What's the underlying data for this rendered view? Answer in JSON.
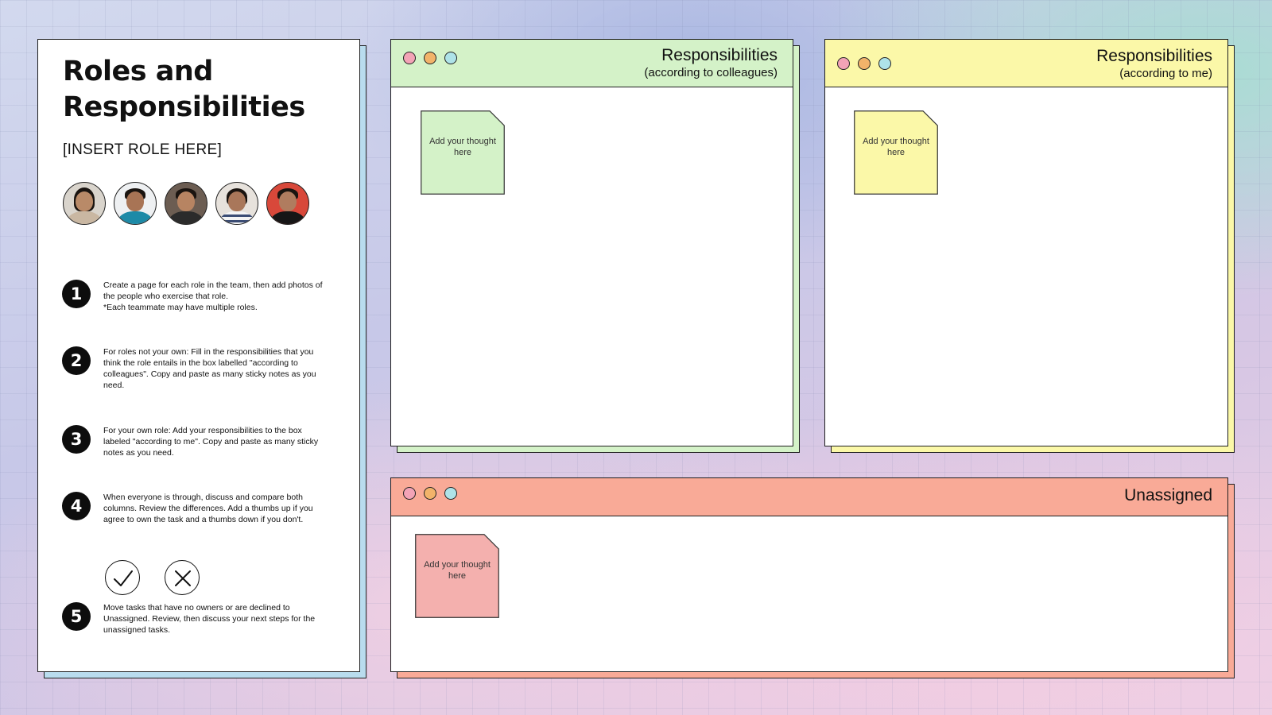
{
  "instructions": {
    "title": "Roles and Responsibilities",
    "role_placeholder": "[INSERT ROLE HERE]",
    "steps": [
      {
        "number": "1",
        "text": "Create a page for each role in the team, then add photos of the people who exercise that role.\n*Each teammate may have multiple roles."
      },
      {
        "number": "2",
        "text": "For roles not your own: Fill in the responsibilities that you think the role entails in the box labelled \"according to colleagues\". Copy and paste as many sticky notes as you need."
      },
      {
        "number": "3",
        "text": "For your own role: Add your responsibilities to the box labeled \"according to me\". Copy and paste as many sticky notes as you need."
      },
      {
        "number": "4",
        "text": "When everyone is through, discuss and compare both columns. Review the differences. Add a thumbs up if you agree to own the task and a thumbs down if you don't."
      },
      {
        "number": "5",
        "text": "Move tasks that have no owners or are declined to Unassigned. Review, then discuss your next steps for the unassigned tasks."
      }
    ],
    "vote_icons": [
      "check-circle-icon",
      "x-circle-icon"
    ]
  },
  "boards": {
    "colleagues": {
      "title": "Responsibilities",
      "subtitle": "(according to colleagues)",
      "color": "#d4f2c8",
      "sticky_text": "Add your thought here",
      "sticky_color": "#d4f2c8"
    },
    "me": {
      "title": "Responsibilities",
      "subtitle": "(according to me)",
      "color": "#fbf8a8",
      "sticky_text": "Add your thought here",
      "sticky_color": "#fbf8a8"
    },
    "unassigned": {
      "title": "Unassigned",
      "color": "#f9aa97",
      "sticky_text": "Add your thought here",
      "sticky_color": "#f4b0ae"
    }
  },
  "window_dot_colors": [
    "#f3a3b6",
    "#f2b36a",
    "#aee3e8"
  ]
}
